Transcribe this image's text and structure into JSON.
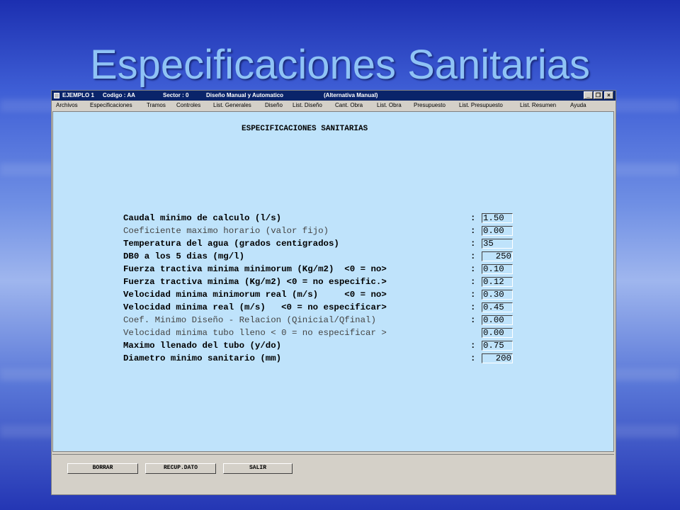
{
  "slide": {
    "title": "Especificaciones Sanitarias"
  },
  "window": {
    "title": {
      "project": "EJEMPLO 1",
      "code": "Codigo : AA",
      "sector": "Sector : 0",
      "mode": "Diseño Manual y Automatico",
      "alternative": "(Alternativa Manual)"
    },
    "controls": {
      "minimize": "_",
      "restore": "❐",
      "close": "×"
    }
  },
  "menu": [
    "Archivos",
    "Especificaciones",
    "Tramos",
    "Controles",
    "List. Generales",
    "Diseño",
    "List. Diseño",
    "Cant. Obra",
    "List. Obra",
    "Presupuesto",
    "List. Presupuesto",
    "List. Resumen",
    "Ayuda"
  ],
  "form": {
    "heading": "ESPECIFICACIONES SANITARIAS",
    "rows": [
      {
        "label": "Caudal minimo de calculo (l/s)",
        "value": "1.50"
      },
      {
        "label": "Coeficiente maximo horario (valor fijo)",
        "value": "0.00"
      },
      {
        "label": "Temperatura del agua (grados centigrados)",
        "value": "35"
      },
      {
        "label": "DB0 a los 5 dias (mg/l)",
        "value": "250"
      },
      {
        "label": "Fuerza tractiva minima minimorum (Kg/m2)  <0 = no>",
        "value": "0.10"
      },
      {
        "label": "Fuerza tractiva minima (Kg/m2) <0 = no especific.>",
        "value": "0.12"
      },
      {
        "label": "Velocidad minima minimorum real (m/s)     <0 = no>",
        "value": "0.30"
      },
      {
        "label": "Velocidad minima real (m/s)   <0 = no especificar>",
        "value": "0.45"
      },
      {
        "label": "Coef. Minimo Diseño - Relacion (Qinicial/Qfinal)",
        "value": "0.00"
      },
      {
        "label": "Velocidad minima tubo lleno < 0 = no especificar >",
        "value": "0.00"
      },
      {
        "label": "Maximo llenado del tubo (y/do)",
        "value": "0.75"
      },
      {
        "label": "Diametro minimo sanitario (mm)",
        "value": "200"
      }
    ],
    "colon": ":"
  },
  "buttons": {
    "borrar": "BORRAR",
    "recuperar": "RECUP.DATO",
    "salir": "SALIR"
  }
}
